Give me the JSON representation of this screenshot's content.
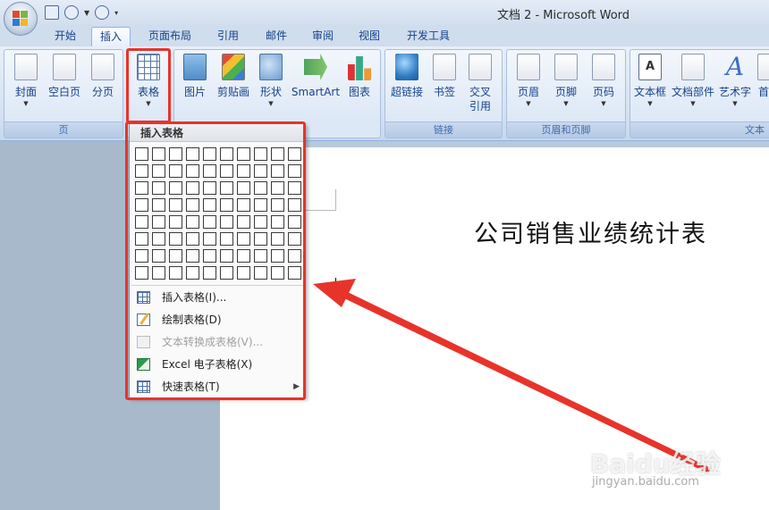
{
  "window": {
    "title": "文档 2 - Microsoft Word"
  },
  "tabs": [
    {
      "label": "开始"
    },
    {
      "label": "插入"
    },
    {
      "label": "页面布局"
    },
    {
      "label": "引用"
    },
    {
      "label": "邮件"
    },
    {
      "label": "审阅"
    },
    {
      "label": "视图"
    },
    {
      "label": "开发工具"
    }
  ],
  "ribbon": {
    "groups": {
      "pages": {
        "label": "页",
        "buttons": [
          "封面",
          "空白页",
          "分页"
        ]
      },
      "tables": {
        "buttons": [
          "表格"
        ]
      },
      "illustrations": {
        "buttons": [
          "图片",
          "剪贴画",
          "形状",
          "SmartArt",
          "图表"
        ]
      },
      "links": {
        "label": "链接",
        "buttons": [
          "超链接",
          "书签",
          "交叉\n引用"
        ]
      },
      "header_footer": {
        "label": "页眉和页脚",
        "buttons": [
          "页眉",
          "页脚",
          "页码"
        ]
      },
      "text": {
        "label": "文本",
        "buttons": [
          "文本框",
          "文档部件",
          "艺术字",
          "首字"
        ]
      }
    }
  },
  "dropdown": {
    "header": "插入表格",
    "grid": {
      "columns": 10,
      "rows": 8
    },
    "items": [
      {
        "label": "插入表格(I)...",
        "icon": "table-icon",
        "enabled": true
      },
      {
        "label": "绘制表格(D)",
        "icon": "draw-table-icon",
        "enabled": true
      },
      {
        "label": "文本转换成表格(V)...",
        "icon": "convert-text-icon",
        "enabled": false
      },
      {
        "label": "Excel 电子表格(X)",
        "icon": "excel-icon",
        "enabled": true
      },
      {
        "label": "快速表格(T)",
        "icon": "quick-table-icon",
        "enabled": true,
        "submenu": true
      }
    ]
  },
  "document": {
    "title": "公司销售业绩统计表"
  },
  "watermark": {
    "brand": "Baidu经验",
    "url": "jingyan.baidu.com"
  },
  "colors": {
    "highlight": "#e8332a",
    "ribbon_text": "#15428b"
  }
}
